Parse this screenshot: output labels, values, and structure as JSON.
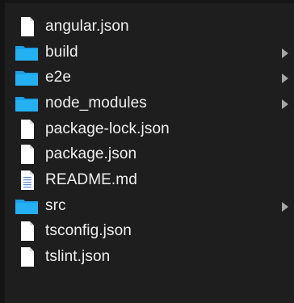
{
  "items": [
    {
      "name": "angular.json",
      "kind": "file",
      "icon": "file-icon",
      "expandable": false
    },
    {
      "name": "build",
      "kind": "folder",
      "icon": "folder-icon",
      "expandable": true
    },
    {
      "name": "e2e",
      "kind": "folder",
      "icon": "folder-icon",
      "expandable": true
    },
    {
      "name": "node_modules",
      "kind": "folder",
      "icon": "folder-icon",
      "expandable": true
    },
    {
      "name": "package-lock.json",
      "kind": "file",
      "icon": "file-icon",
      "expandable": false
    },
    {
      "name": "package.json",
      "kind": "file",
      "icon": "file-icon",
      "expandable": false
    },
    {
      "name": "README.md",
      "kind": "text-file",
      "icon": "text-file-icon",
      "expandable": false
    },
    {
      "name": "src",
      "kind": "folder",
      "icon": "folder-icon",
      "expandable": true
    },
    {
      "name": "tsconfig.json",
      "kind": "file",
      "icon": "file-icon",
      "expandable": false
    },
    {
      "name": "tslint.json",
      "kind": "file",
      "icon": "file-icon",
      "expandable": false
    }
  ],
  "colors": {
    "background": "#1e1e1e",
    "text": "#f0f0f0",
    "folder": "#1aa0e6",
    "file": "#ffffff",
    "chevron": "#a6a6a6"
  }
}
